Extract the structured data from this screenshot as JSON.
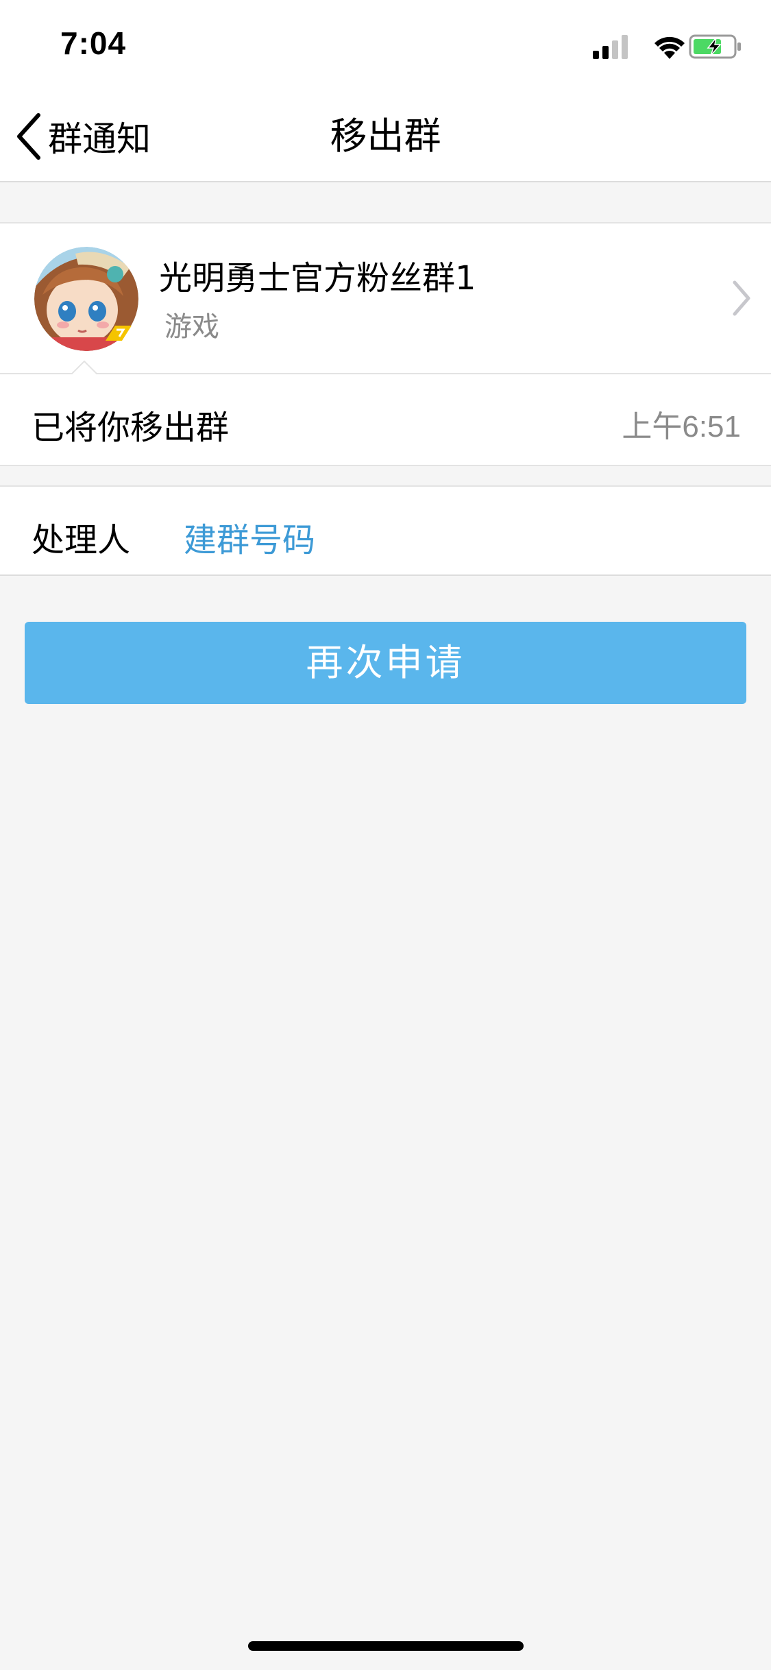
{
  "status_bar": {
    "time": "7:04",
    "signal_icon": "cellular-signal-icon",
    "wifi_icon": "wifi-icon",
    "battery_icon": "battery-charging-icon",
    "battery_color": "#4cd964"
  },
  "nav": {
    "back_label": "群通知",
    "back_icon": "chevron-left-icon",
    "title": "移出群"
  },
  "group": {
    "name": "光明勇士官方粉丝群1",
    "category": "游戏",
    "avatar_icon": "group-avatar",
    "chevron_icon": "chevron-right-icon"
  },
  "message": {
    "text": "已将你移出群",
    "time": "上午6:51"
  },
  "handler": {
    "label": "处理人",
    "value": "建群号码"
  },
  "actions": {
    "reapply_label": "再次申请"
  },
  "colors": {
    "accent": "#5ab6ec",
    "link": "#3d9ad6",
    "background": "#f5f5f5",
    "secondary_text": "#8a8a8a"
  }
}
